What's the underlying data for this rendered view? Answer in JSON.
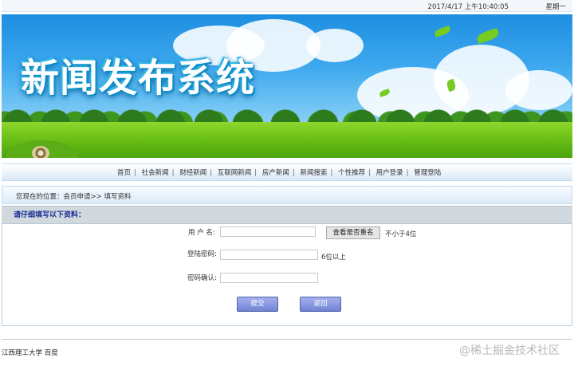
{
  "header": {
    "date": "2017/4/17 上午10:40:05",
    "weekday": "星期一"
  },
  "banner": {
    "title": "新闻发布系统"
  },
  "nav": {
    "items": [
      "首页",
      "社会新闻",
      "财经新闻",
      "互联网新闻",
      "房产新闻",
      "新闻搜索",
      "个性推荐",
      "用户登录",
      "管理登陆"
    ]
  },
  "location": {
    "text": "您现在的位置：会员申请>> 填写资料"
  },
  "form": {
    "section_title": "请仔细填写以下资料：",
    "username_label": "用 户 名:",
    "username_value": "",
    "check_button": "查看是否重名",
    "username_hint": "不小于4位",
    "password_label": "登陆密码:",
    "password_value": "",
    "password_hint": "6位以上",
    "confirm_label": "密码确认:",
    "confirm_value": "",
    "submit_button": "提交",
    "back_button": "返回"
  },
  "footer": {
    "text": "江西理工大学  百度",
    "watermark": "@稀土掘金技术社区"
  }
}
